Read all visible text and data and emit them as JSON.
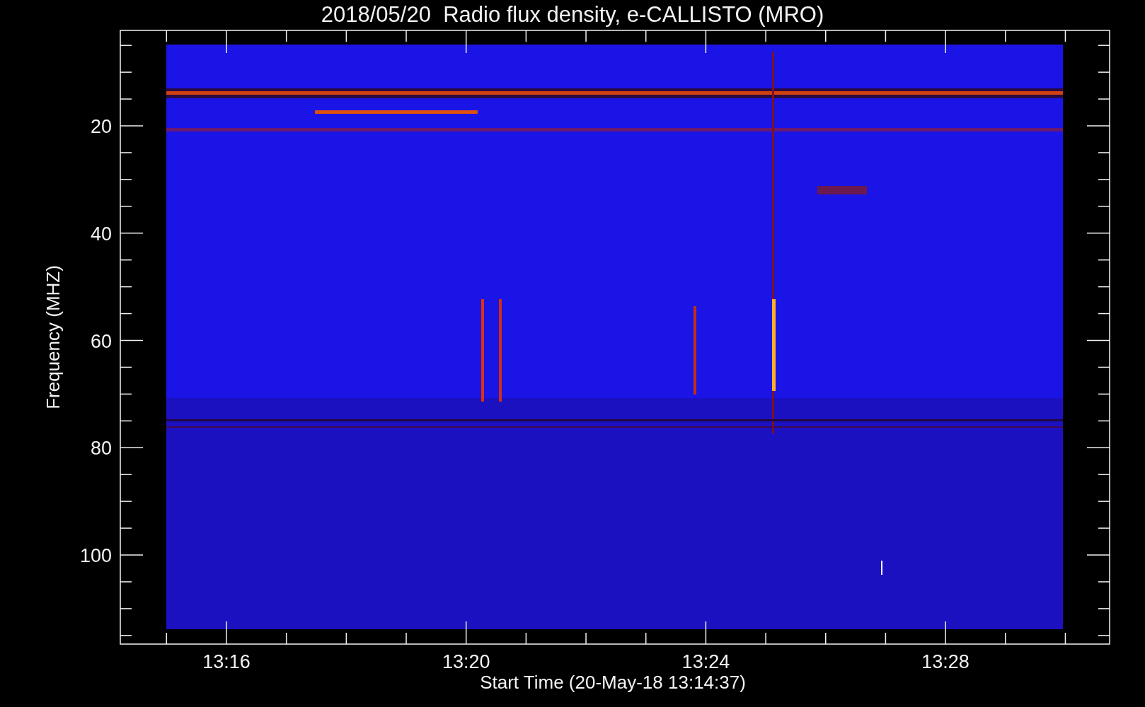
{
  "title": "2018/05/20  Radio flux density, e-CALLISTO (MRO)",
  "y_axis": {
    "title": "Frequency (MHZ)",
    "ticks": [
      "20",
      "40",
      "60",
      "80",
      "100"
    ]
  },
  "x_axis": {
    "title": "Start Time (20-May-18 13:14:37)",
    "ticks": [
      "13:16",
      "13:20",
      "13:24",
      "13:28"
    ]
  }
}
